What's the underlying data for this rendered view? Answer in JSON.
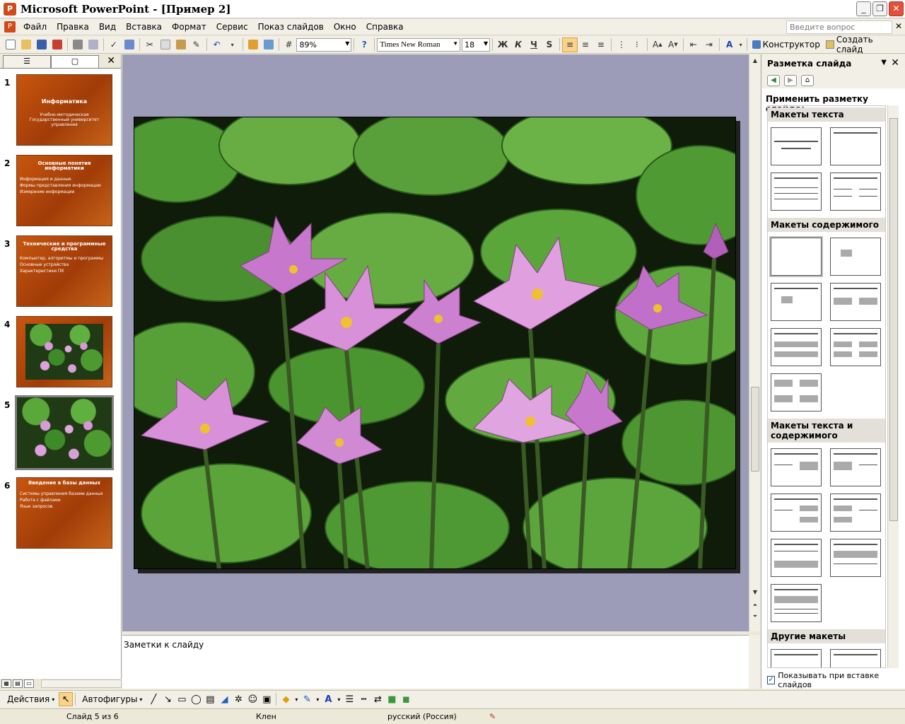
{
  "window": {
    "title": "Microsoft PowerPoint - [Пример 2]",
    "minimize": "_",
    "maximize": "❐",
    "close": "✕"
  },
  "menu": {
    "items": [
      "Файл",
      "Правка",
      "Вид",
      "Вставка",
      "Формат",
      "Сервис",
      "Показ слайдов",
      "Окно",
      "Справка"
    ],
    "help_placeholder": "Введите вопрос"
  },
  "toolbar": {
    "zoom": "89%",
    "font_name": "Times New Roman",
    "font_size": "18",
    "bold": "Ж",
    "italic": "К",
    "underline": "Ч",
    "shadow": "S",
    "designer_label": "Конструктор",
    "new_slide_label": "Создать слайд"
  },
  "slides_panel": {
    "close": "✕",
    "thumbnails": [
      {
        "number": "1",
        "title": "Информатика",
        "lines": [
          "Учебно-методическая",
          "Государственный университет управления"
        ]
      },
      {
        "number": "2",
        "title": "Основные понятия информатики",
        "lines": [
          "Информация и данные",
          "Формы представления информации",
          "Измерение информации"
        ]
      },
      {
        "number": "3",
        "title": "Технические и программные средства",
        "lines": [
          "Компьютер, алгоритмы и программы",
          "Основные устройства",
          "Характеристики ПК"
        ]
      },
      {
        "number": "4",
        "title": "",
        "lines": []
      },
      {
        "number": "5",
        "title": "",
        "lines": []
      },
      {
        "number": "6",
        "title": "Введение в базы данных",
        "lines": [
          "Системы управления базами данных",
          "Работа с файлами",
          "Язык запросов"
        ]
      }
    ]
  },
  "notes": {
    "placeholder": "Заметки к слайду"
  },
  "taskpane": {
    "title": "Разметка слайда",
    "apply_label": "Применить разметку слайда:",
    "sections": [
      "Макеты текста",
      "Макеты содержимого",
      "Макеты текста и содержимого",
      "Другие макеты"
    ],
    "show_on_insert": "Показывать при вставке слайдов"
  },
  "drawing": {
    "actions": "Действия",
    "autoshapes": "Автофигуры"
  },
  "status": {
    "slide": "Слайд 5 из 6",
    "design": "Клен",
    "language": "русский (Россия)"
  }
}
